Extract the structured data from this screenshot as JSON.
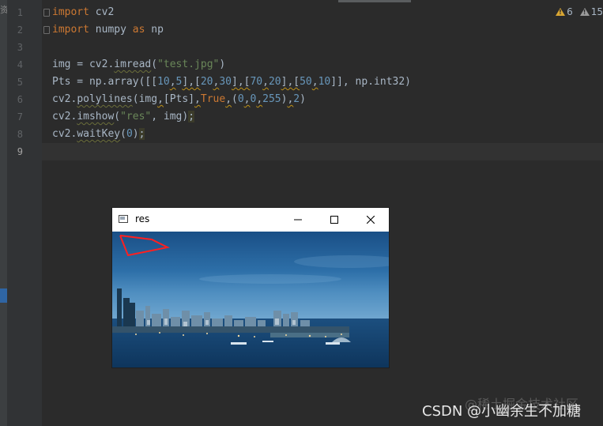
{
  "editor": {
    "left_strip_glyph": "资",
    "line_numbers": [
      "1",
      "2",
      "3",
      "4",
      "5",
      "6",
      "7",
      "8",
      "9"
    ],
    "code": {
      "l1": {
        "kw": "import",
        "rest": " cv2"
      },
      "l2": {
        "kw": "import",
        "mid": " numpy ",
        "kw2": "as",
        "rest": " np"
      },
      "l4": {
        "a": "img = cv2.",
        "fn": "imread",
        "b": "(",
        "str": "\"test.jpg\"",
        "c": ")"
      },
      "l5": {
        "a": "Pts = np.array([[",
        "n1": "10",
        "c1": ",",
        "n2": "5",
        "c2": "],[",
        "n3": "20",
        "c3": ",",
        "n4": "30",
        "c4": "],[",
        "n5": "70",
        "c5": ",",
        "n6": "20",
        "c6": "],[",
        "n7": "50",
        "c7": ",",
        "n8": "10",
        "d": "]], np.int32)"
      },
      "l6": {
        "a": "cv2.",
        "fn": "polylines",
        "b": "(img",
        "c1": ",",
        "d": "[Pts]",
        "c2": ",",
        "kw": "True",
        "c3": ",",
        "e": "(",
        "n1": "0",
        "c4": ",",
        "n2": "0",
        "c5": ",",
        "n3": "255",
        "f": ")",
        "c6": ",",
        "n4": "2",
        "g": ")"
      },
      "l7": {
        "a": "cv2.",
        "fn": "imshow",
        "b": "(",
        "str": "\"res\"",
        "c": ", img)",
        "semi": ";"
      },
      "l8": {
        "a": "cv2.",
        "fn": "waitKey",
        "b": "(",
        "n1": "0",
        "c": ")",
        "semi": ";"
      }
    }
  },
  "inspections": {
    "warnings_count": "6",
    "weak_warnings_count": "15",
    "warning_icon": "warning-triangle-icon",
    "weak_warning_icon": "weak-warning-triangle-icon"
  },
  "image_window": {
    "title": "res",
    "minimize_icon": "minimize-icon",
    "maximize_icon": "maximize-icon",
    "close_icon": "close-icon",
    "image": "city skyline by the sea with red polyline drawn top-left"
  },
  "watermark": {
    "text": "CSDN @小幽余生不加糖",
    "ghost_text": "@稀土掘金技术社区"
  },
  "colors": {
    "editor_bg": "#2b2b2b",
    "keyword": "#cc7832",
    "string": "#6a8759",
    "number": "#6897bb",
    "polyline": "#ff2020"
  }
}
